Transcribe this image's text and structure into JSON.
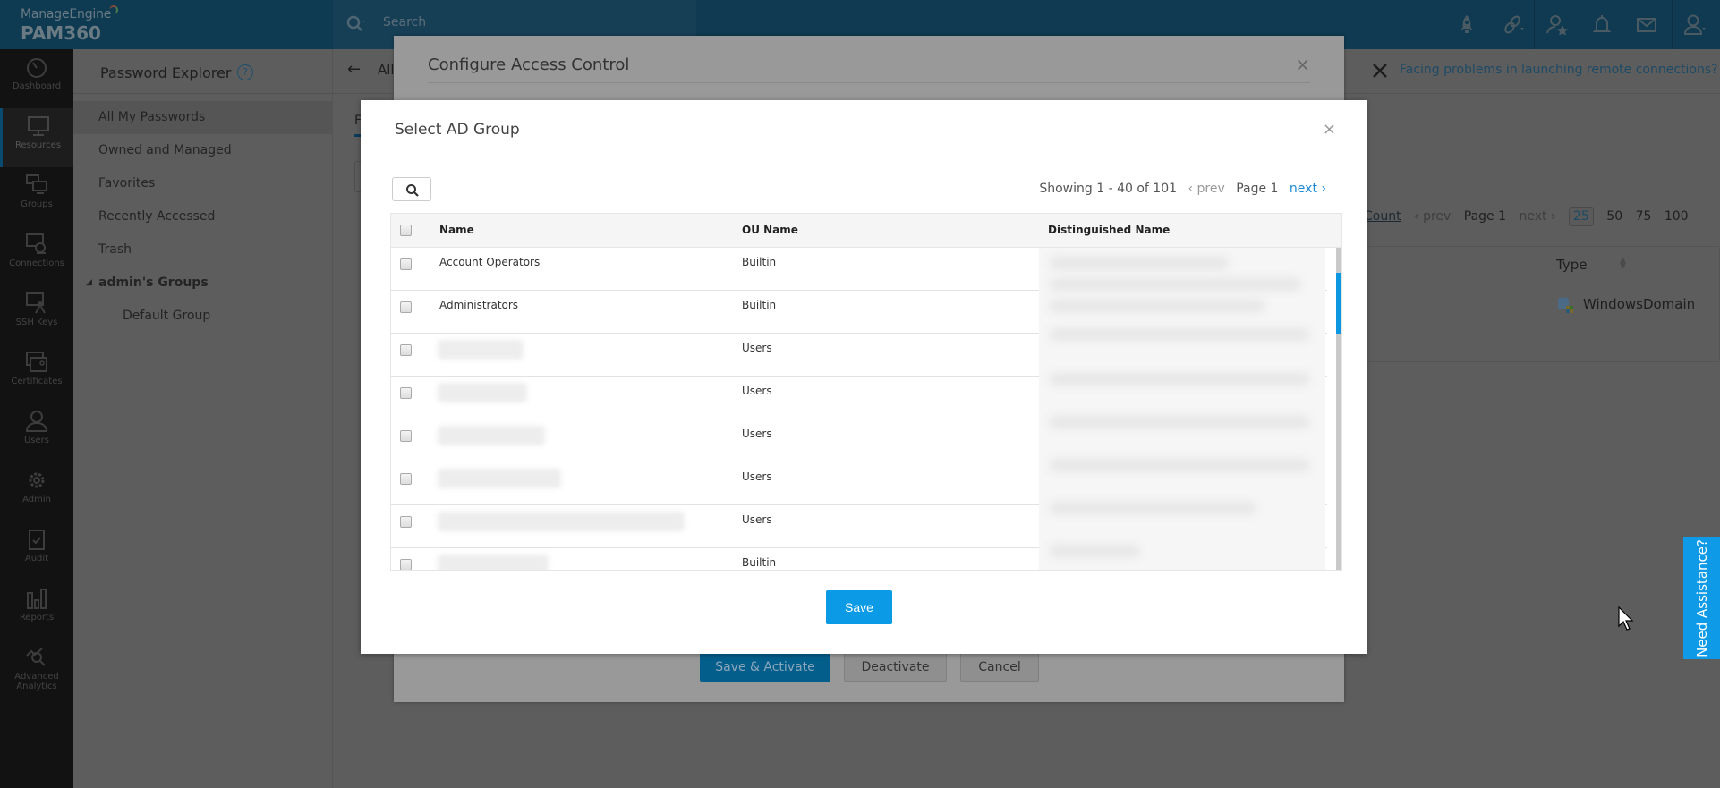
{
  "header": {
    "brand": "ManageEngine",
    "product": "PAM360",
    "search_placeholder": "Search",
    "icons": [
      "rocket-icon",
      "link-icon",
      "user-star-icon",
      "bell-icon",
      "mail-icon",
      "user-icon"
    ]
  },
  "nav": {
    "items": [
      {
        "label": "Dashboard",
        "icon": "dashboard-icon"
      },
      {
        "label": "Resources",
        "icon": "monitor-icon",
        "active": true
      },
      {
        "label": "Groups",
        "icon": "groups-icon"
      },
      {
        "label": "Connections",
        "icon": "connections-icon"
      },
      {
        "label": "SSH Keys",
        "icon": "ssh-keys-icon"
      },
      {
        "label": "Certificates",
        "icon": "certificate-icon"
      },
      {
        "label": "Users",
        "icon": "user-icon"
      },
      {
        "label": "Admin",
        "icon": "gear-icon"
      },
      {
        "label": "Audit",
        "icon": "clipboard-check-icon"
      },
      {
        "label": "Reports",
        "icon": "bar-chart-icon"
      },
      {
        "label": "Advanced Analytics",
        "icon": "analytics-icon"
      }
    ]
  },
  "explorer": {
    "title": "Password Explorer",
    "help": "?",
    "items": [
      {
        "label": "All My Passwords",
        "active": true
      },
      {
        "label": "Owned and Managed"
      },
      {
        "label": "Favorites"
      },
      {
        "label": "Recently Accessed"
      },
      {
        "label": "Trash"
      },
      {
        "label": "admin's Groups",
        "group": true
      },
      {
        "label": "Default Group",
        "sub": true
      }
    ]
  },
  "content": {
    "back_arrow": "←",
    "breadcrumb": "All",
    "tab_letter": "F",
    "remote_help": "Facing problems in launching remote connections?",
    "pager": {
      "count_label": "Count",
      "prev": "‹ prev",
      "page": "Page 1",
      "next": "next ›",
      "sizes": [
        "25",
        "50",
        "75",
        "100"
      ],
      "selected_size": "25"
    },
    "grid": {
      "header_type": "Type",
      "type_value": "WindowsDomain"
    }
  },
  "outer_dialog": {
    "title": "Configure Access Control",
    "close": "×",
    "buttons": {
      "save_activate": "Save & Activate",
      "deactivate": "Deactivate",
      "cancel": "Cancel"
    }
  },
  "modal": {
    "title": "Select AD Group",
    "close": "×",
    "paging": {
      "showing": "Showing 1 - 40 of 101",
      "prev": "‹ prev",
      "page": "Page 1",
      "next": "next ›"
    },
    "columns": {
      "name": "Name",
      "ou": "OU Name",
      "dn": "Distinguished Name"
    },
    "rows": [
      {
        "name": "Account Operators",
        "ou": "Builtin"
      },
      {
        "name": "Administrators",
        "ou": "Builtin"
      },
      {
        "name": "",
        "ou": "Users",
        "redacted": true
      },
      {
        "name": "",
        "ou": "Users",
        "redacted": true
      },
      {
        "name": "",
        "ou": "Users",
        "redacted": true
      },
      {
        "name": "",
        "ou": "Users",
        "redacted": true
      },
      {
        "name": "",
        "ou": "Users",
        "redacted": true
      },
      {
        "name": "",
        "ou": "Builtin",
        "redacted": true
      }
    ],
    "save_label": "Save"
  },
  "assist": {
    "label": "Need Assistance?"
  },
  "colors": {
    "primary_blue": "#0b9ae6",
    "link_blue": "#1a8ad4",
    "header_navy": "#003b57",
    "save_activate": "#045e8b"
  }
}
